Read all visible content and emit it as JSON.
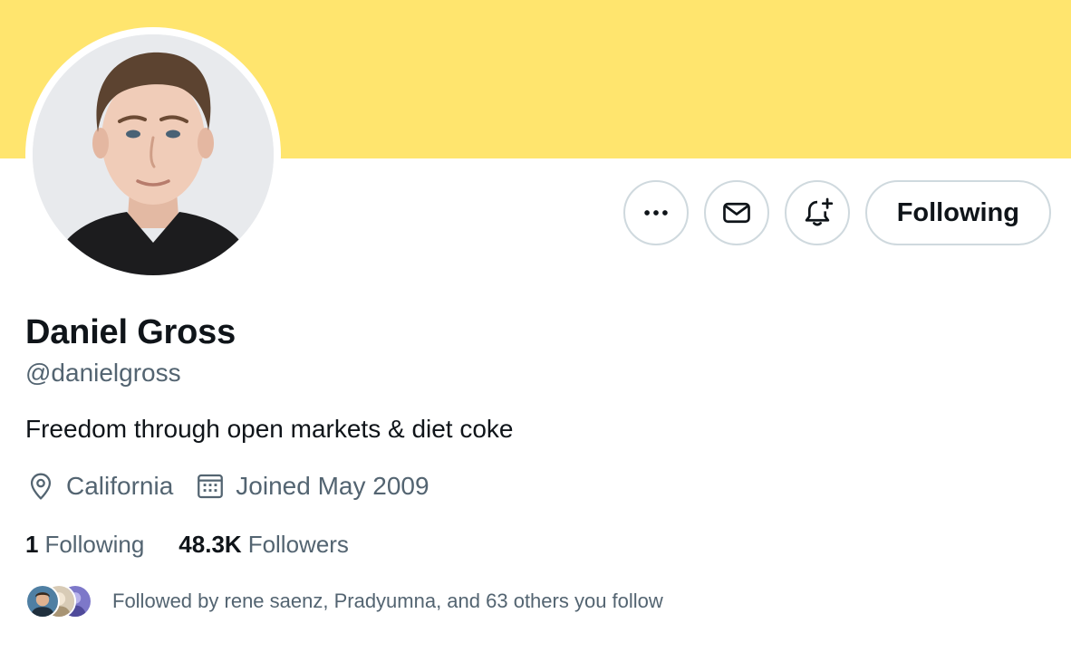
{
  "profile": {
    "banner_color": "#ffe56e",
    "avatar_icon": "profile-photo",
    "name": "Daniel Gross",
    "handle": "@danielgross",
    "bio": "Freedom through open markets & diet coke",
    "location": "California",
    "joined": "Joined May 2009"
  },
  "actions": {
    "more_icon": "more-horizontal-icon",
    "message_icon": "envelope-icon",
    "notify_icon": "bell-plus-icon",
    "following_label": "Following"
  },
  "meta_icons": {
    "location_icon": "location-pin-icon",
    "joined_icon": "calendar-icon"
  },
  "stats": {
    "following_count": "1",
    "following_label": "Following",
    "followers_count": "48.3K",
    "followers_label": "Followers"
  },
  "followed_by": {
    "text": "Followed by rene saenz, Pradyumna, and 63 others you follow"
  },
  "colors": {
    "primary_text": "#0f1419",
    "secondary_text": "#536471",
    "border": "#cfd9de"
  }
}
